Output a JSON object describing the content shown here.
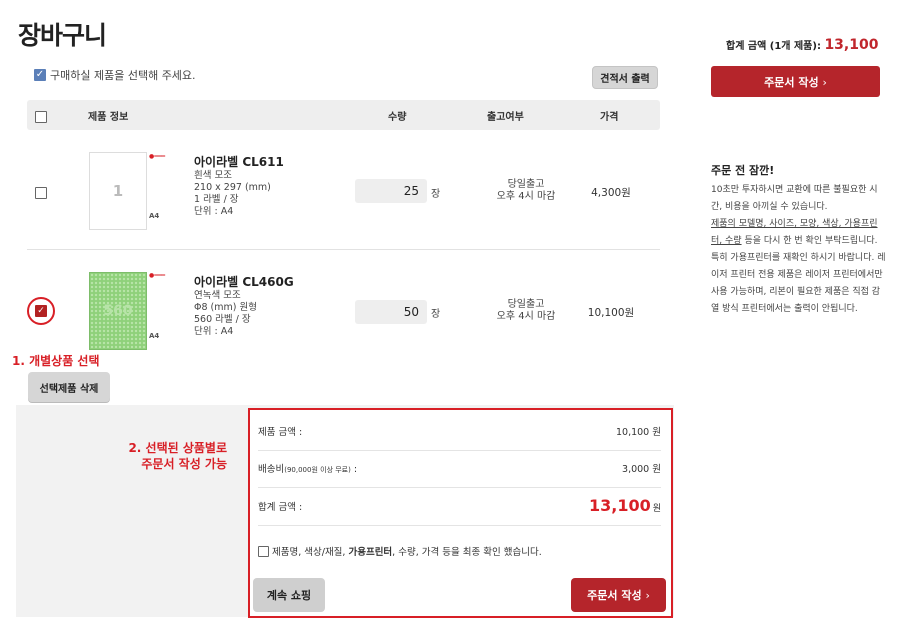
{
  "page": {
    "title": "장바구니"
  },
  "instruction": {
    "icon": "checkbox-checked-icon",
    "text": "구매하실 제품을 선택해 주세요."
  },
  "toolbar": {
    "quote_label": "견적서 출력"
  },
  "table": {
    "headers": {
      "product": "제품 정보",
      "qty": "수량",
      "shipping": "출고여부",
      "price": "가격"
    }
  },
  "items": [
    {
      "selected": false,
      "thumb_text": "1",
      "name": "아이라벨 CL611",
      "specs": [
        "흰색 모조",
        "210 x 297 (mm)",
        "1 라벨 / 장",
        "단위 : A4"
      ],
      "qty": "25",
      "unit": "장",
      "shipping": [
        "당일출고",
        "오후 4시 마감"
      ],
      "price": "4,300원"
    },
    {
      "selected": true,
      "thumb_text": "560",
      "name": "아이라벨 CL460G",
      "specs": [
        "연녹색 모조",
        "Φ8 (mm) 원형",
        "560 라벨 / 장",
        "단위 : A4"
      ],
      "qty": "50",
      "unit": "장",
      "shipping": [
        "당일출고",
        "오후 4시 마감"
      ],
      "price": "10,100원"
    }
  ],
  "thumb_labels": {
    "logo": "●═══",
    "a4": "A4"
  },
  "annotations": {
    "step1": "1. 개별상품 선택",
    "step2_line1": "2. 선택된 상품별로",
    "step2_line2": "주문서 작성 가능"
  },
  "actions": {
    "delete_selected": "선택제품 삭제"
  },
  "summary": {
    "product_amount_label": "제품 금액 :",
    "product_amount": "10,100 원",
    "shipping_label": "배송비",
    "shipping_note": "(90,000원 이상 무료)",
    "shipping_suffix": " :",
    "shipping_amount": "3,000 원",
    "total_label": "합계 금액 :",
    "total_amount": "13,100",
    "total_unit": "원",
    "confirm_pre": "제품명, 색상/재질, ",
    "confirm_bold": "가용프린터",
    "confirm_post": ", 수량, 가격 등을 최종 확인 했습니다.",
    "continue_label": "계속 쇼핑",
    "order_label": "주문서 작성"
  },
  "sidebar": {
    "total_prefix": "합계 금액 (1개 제품):",
    "total_amount": "13,100",
    "order_label": "주문서 작성",
    "chevron": "›",
    "notice_title": "주문 전 잠깐!",
    "notice_p1": "10초만 투자하시면 교환에 따른 불필요한 시간, 비용을 아끼실 수 있습니다.",
    "notice_p2_ul": "제품의 모델명, 사이즈, 모양, 색상, 가용프린터, 수량",
    "notice_p2_rest": "등을 다시 한 번 확인 부탁드립니다.",
    "notice_p3": "특히 가용프린터를 재확인 하시기 바랍니다. 레이저 프린터 전용 제품은 레이저 프린터에서만 사용 가능하며, 리본이 필요한 제품은 직접 감열 방식 프린터에서는 출력이 안됩니다."
  },
  "colors": {
    "accent": "#b5252b",
    "annotation": "#d81f26",
    "header_bg": "#eeeeee"
  }
}
